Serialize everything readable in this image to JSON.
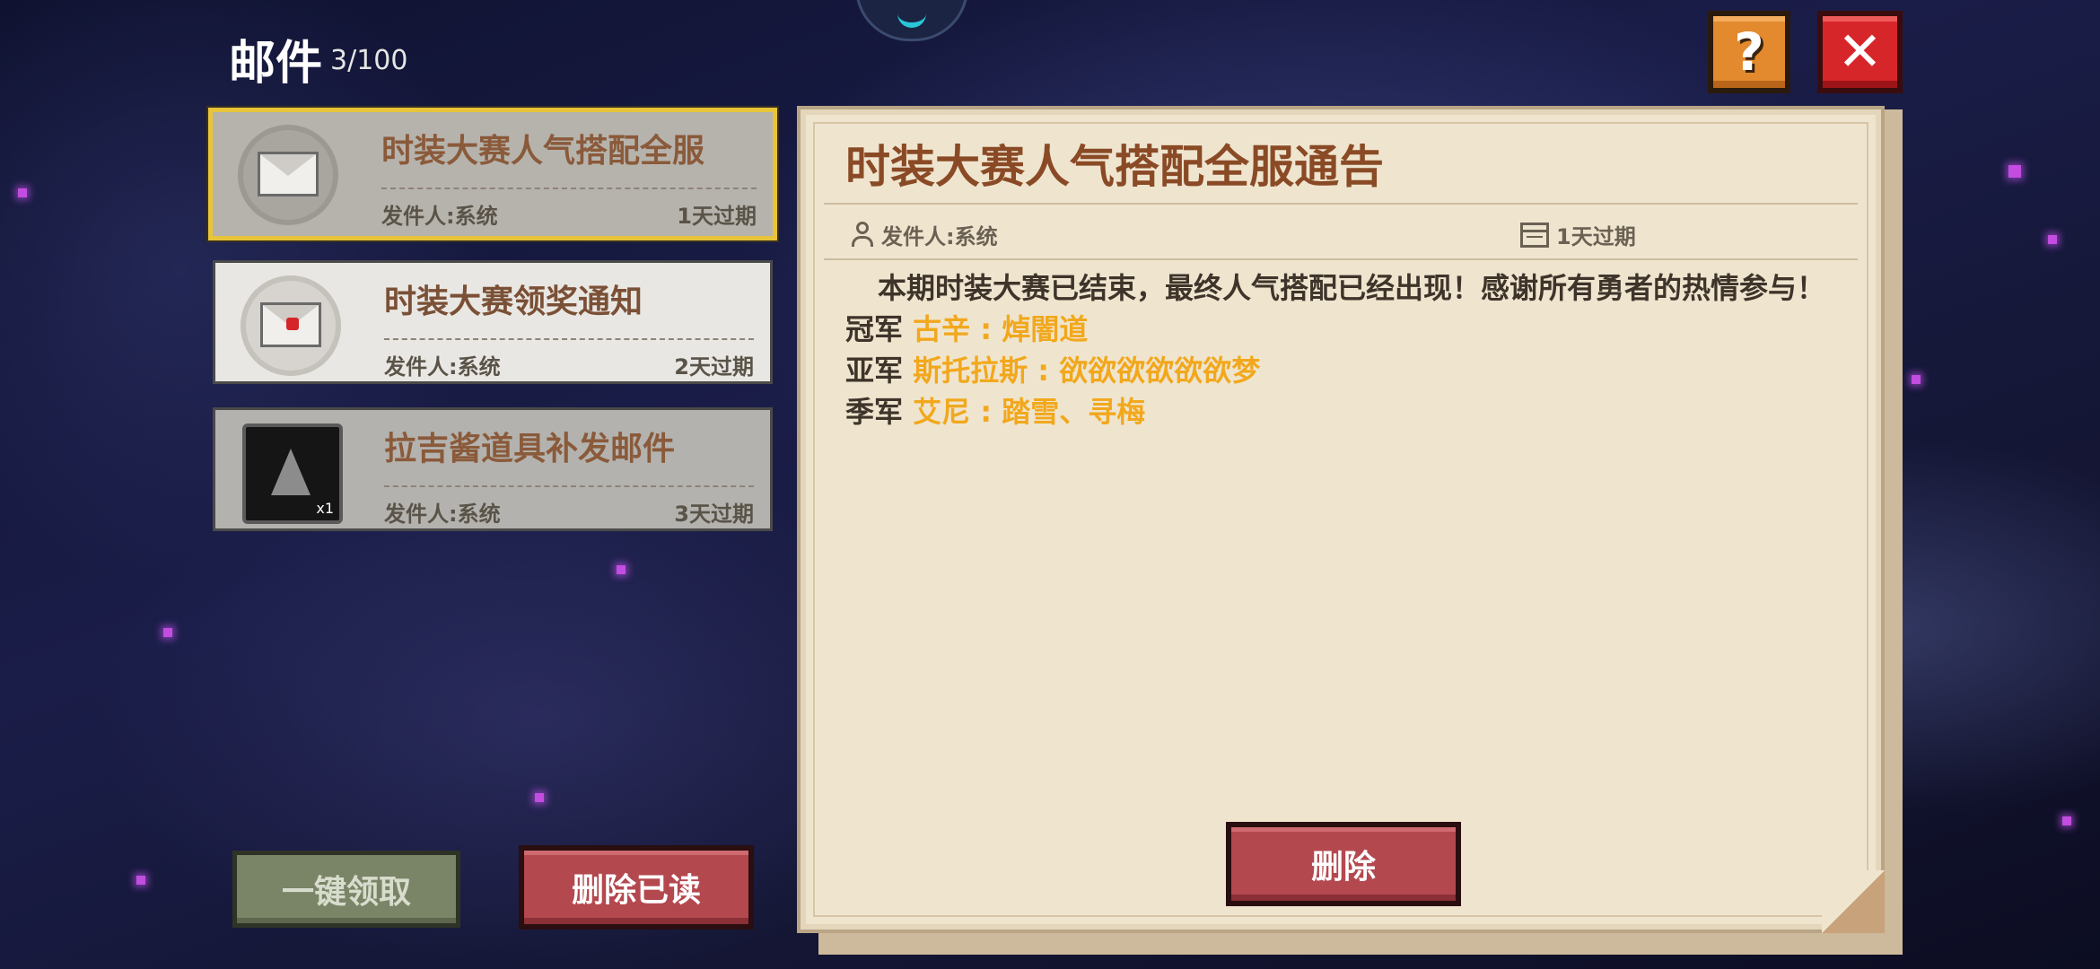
{
  "header": {
    "title": "邮件",
    "count": "3/100"
  },
  "buttons": {
    "help": "?",
    "close": "✕",
    "claim_all": "一键领取",
    "delete_read": "删除已读",
    "delete": "删除"
  },
  "mail_list": [
    {
      "title": "时装大赛人气搭配全服",
      "sender": "发件人:系统",
      "expire": "1天过期",
      "icon": "opened-envelope-icon",
      "selected": true
    },
    {
      "title": "时装大赛领奖通知",
      "sender": "发件人:系统",
      "expire": "2天过期",
      "icon": "sealed-envelope-icon",
      "selected": false
    },
    {
      "title": "拉吉酱道具补发邮件",
      "sender": "发件人:系统",
      "expire": "3天过期",
      "icon": "item-shard-icon",
      "item_qty": "x1",
      "selected": false
    }
  ],
  "detail": {
    "title": "时装大赛人气搭配全服通告",
    "sender": "发件人:系统",
    "expire": "1天过期",
    "body_intro": "本期时装大赛已结束，最终人气搭配已经出现！感谢所有勇者的热情参与！",
    "rankings": [
      {
        "rank": "冠军",
        "winner": "古辛 : 焯闇道"
      },
      {
        "rank": "亚军",
        "winner": "斯托拉斯 : 欲欲欲欲欲欲梦"
      },
      {
        "rank": "季军",
        "winner": "艾尼 : 踏雪、寻梅"
      }
    ]
  },
  "colors": {
    "highlight": "#f2a81d",
    "selected_border": "#e8c43a",
    "delete_button": "#b4484f",
    "claim_button": "#7a8466",
    "close_button": "#d7262a",
    "help_button": "#e38a2e"
  }
}
